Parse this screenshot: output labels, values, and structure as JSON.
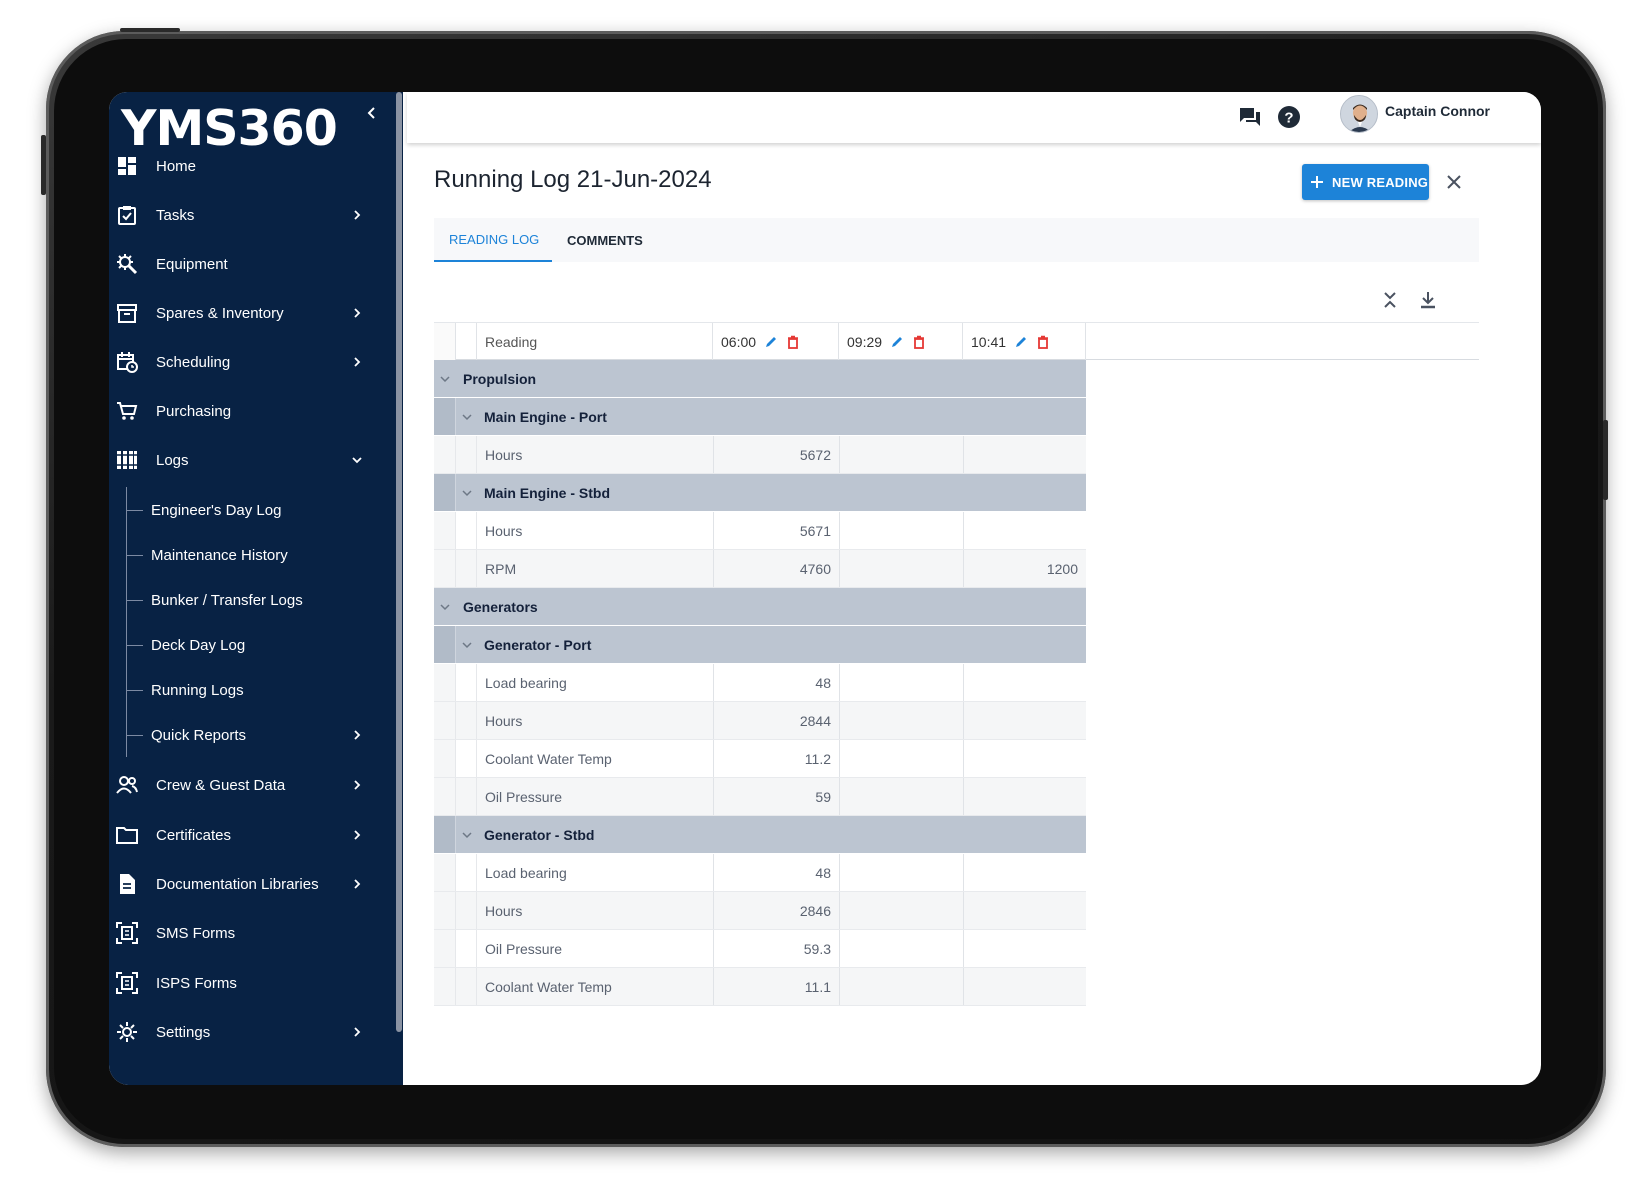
{
  "app": {
    "logo": "YMS360",
    "user_name": "Captain Connor"
  },
  "sidebar": {
    "items": [
      {
        "label": "Home",
        "icon": "dashboard-icon"
      },
      {
        "label": "Tasks",
        "icon": "clipboard-icon",
        "has_submenu": true
      },
      {
        "label": "Equipment",
        "icon": "wrench-gear-icon"
      },
      {
        "label": "Spares & Inventory",
        "icon": "archive-box-icon",
        "has_submenu": true
      },
      {
        "label": "Scheduling",
        "icon": "calendar-clock-icon",
        "has_submenu": true
      },
      {
        "label": "Purchasing",
        "icon": "cart-icon"
      },
      {
        "label": "Logs",
        "icon": "books-icon",
        "expanded": true
      },
      {
        "label": "Crew & Guest Data",
        "icon": "people-icon",
        "has_submenu": true
      },
      {
        "label": "Certificates",
        "icon": "folder-icon",
        "has_submenu": true
      },
      {
        "label": "Documentation Libraries",
        "icon": "document-icon",
        "has_submenu": true
      },
      {
        "label": "SMS Forms",
        "icon": "form-scan-icon"
      },
      {
        "label": "ISPS Forms",
        "icon": "form-scan-icon"
      },
      {
        "label": "Settings",
        "icon": "gear-icon",
        "has_submenu": true
      }
    ],
    "logs_children": [
      {
        "label": "Engineer's Day Log"
      },
      {
        "label": "Maintenance History"
      },
      {
        "label": "Bunker / Transfer Logs"
      },
      {
        "label": "Deck Day Log"
      },
      {
        "label": "Running Logs"
      },
      {
        "label": "Quick Reports",
        "has_submenu": true
      }
    ]
  },
  "page": {
    "title": "Running Log 21-Jun-2024",
    "new_reading_label": "NEW READING",
    "tabs": [
      {
        "label": "READING LOG",
        "active": true
      },
      {
        "label": "COMMENTS",
        "active": false
      }
    ]
  },
  "grid": {
    "header": {
      "reading_label": "Reading",
      "times": [
        "06:00",
        "09:29",
        "10:41"
      ]
    },
    "rows": [
      {
        "type": "group1",
        "label": "Propulsion"
      },
      {
        "type": "group2",
        "label": "Main Engine - Port"
      },
      {
        "type": "data",
        "label": "Hours",
        "values": [
          "5672",
          "",
          ""
        ]
      },
      {
        "type": "group2",
        "label": "Main Engine - Stbd"
      },
      {
        "type": "data",
        "label": "Hours",
        "values": [
          "5671",
          "",
          ""
        ]
      },
      {
        "type": "data",
        "label": "RPM",
        "values": [
          "4760",
          "",
          "1200"
        ]
      },
      {
        "type": "group1",
        "label": "Generators"
      },
      {
        "type": "group2",
        "label": "Generator - Port"
      },
      {
        "type": "data",
        "label": "Load bearing",
        "values": [
          "48",
          "",
          ""
        ]
      },
      {
        "type": "data",
        "label": "Hours",
        "values": [
          "2844",
          "",
          ""
        ]
      },
      {
        "type": "data",
        "label": "Coolant Water Temp",
        "values": [
          "11.2",
          "",
          ""
        ]
      },
      {
        "type": "data",
        "label": "Oil Pressure",
        "values": [
          "59",
          "",
          ""
        ]
      },
      {
        "type": "group2",
        "label": "Generator - Stbd"
      },
      {
        "type": "data",
        "label": "Load bearing",
        "values": [
          "48",
          "",
          ""
        ]
      },
      {
        "type": "data",
        "label": "Hours",
        "values": [
          "2846",
          "",
          ""
        ]
      },
      {
        "type": "data",
        "label": "Oil Pressure",
        "values": [
          "59.3",
          "",
          ""
        ]
      },
      {
        "type": "data",
        "label": "Coolant Water Temp",
        "values": [
          "11.1",
          "",
          ""
        ]
      }
    ]
  },
  "colors": {
    "sidebar_bg": "#082244",
    "accent": "#1d83d8",
    "group_row": "#bcc5d1",
    "delete": "#e53935"
  }
}
